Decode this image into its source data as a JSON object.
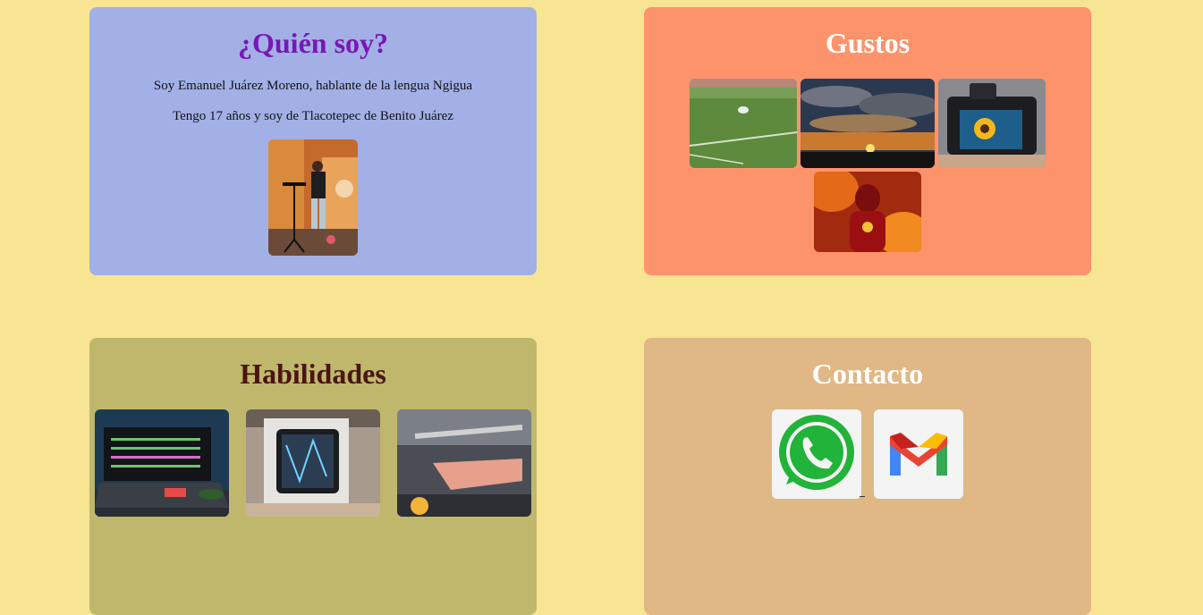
{
  "quien": {
    "title": "¿Quién soy?",
    "line1": "Soy Emanuel Juárez Moreno, hablante de la lengua Ngigua",
    "line2": "Tengo 17 años y soy de Tlacotepec de Benito Juárez"
  },
  "gustos": {
    "title": "Gustos"
  },
  "habilidades": {
    "title": "Habilidades"
  },
  "contacto": {
    "title": "Contacto",
    "links": [
      {
        "icon": "whatsapp-icon"
      },
      {
        "icon": "gmail-icon"
      }
    ]
  },
  "colors": {
    "page_bg": "#f8e594",
    "quien_bg": "#a2b0e6",
    "gustos_bg": "#fd936b",
    "habilidades_bg": "#bfb86c",
    "contacto_bg": "#dfb886",
    "quien_title": "#7a18b4",
    "habilidades_title": "#4a1414"
  }
}
